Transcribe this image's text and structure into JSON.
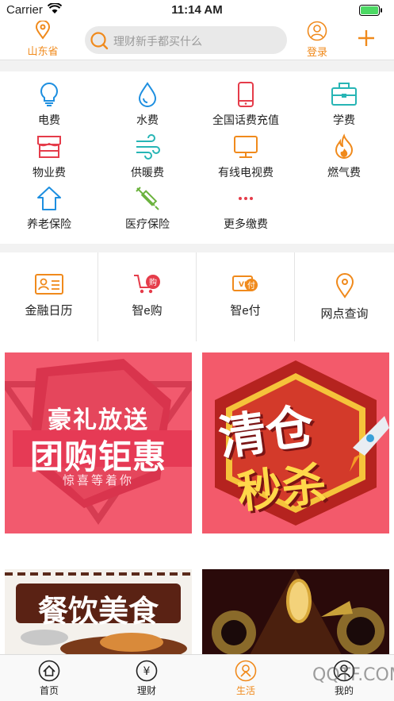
{
  "status_bar": {
    "carrier": "Carrier",
    "time": "11:14 AM"
  },
  "header": {
    "location": "山东省",
    "search_placeholder": "理财新手都买什么",
    "login_label": "登录"
  },
  "services": [
    {
      "label": "电费",
      "icon": "lightbulb-icon"
    },
    {
      "label": "水费",
      "icon": "water-drop-icon"
    },
    {
      "label": "全国话费充值",
      "icon": "phone-icon"
    },
    {
      "label": "学费",
      "icon": "briefcase-icon"
    },
    {
      "label": "物业费",
      "icon": "storefront-icon"
    },
    {
      "label": "供暖费",
      "icon": "wind-icon"
    },
    {
      "label": "有线电视费",
      "icon": "tv-icon"
    },
    {
      "label": "燃气费",
      "icon": "flame-icon"
    },
    {
      "label": "养老保险",
      "icon": "house-arrow-icon"
    },
    {
      "label": "医疗保险",
      "icon": "syringe-icon"
    },
    {
      "label": "更多缴费",
      "icon": "more-dots-icon"
    }
  ],
  "quick_links": [
    {
      "label": "金融日历",
      "icon": "id-card-icon"
    },
    {
      "label": "智e购",
      "icon": "shopping-cart-icon"
    },
    {
      "label": "智e付",
      "icon": "vip-pay-icon"
    },
    {
      "label": "网点查询",
      "icon": "location-pin-icon"
    }
  ],
  "banners": {
    "b1": {
      "line1": "豪礼放送",
      "line2": "团购钜惠",
      "line3": "惊喜等着你"
    },
    "b2": {
      "line1": "清仓",
      "line2": "秒杀"
    },
    "b3": {
      "line1": "餐饮美食"
    }
  },
  "tabs": [
    {
      "label": "首页",
      "icon": "home-icon"
    },
    {
      "label": "理财",
      "icon": "yen-icon"
    },
    {
      "label": "生活",
      "icon": "life-icon"
    },
    {
      "label": "我的",
      "icon": "user-icon"
    }
  ],
  "watermark": "QQTF.COM",
  "colors": {
    "accent": "#f08a1c",
    "blue": "#1e8fe0",
    "red": "#e53c4a",
    "teal": "#27b5b5"
  }
}
